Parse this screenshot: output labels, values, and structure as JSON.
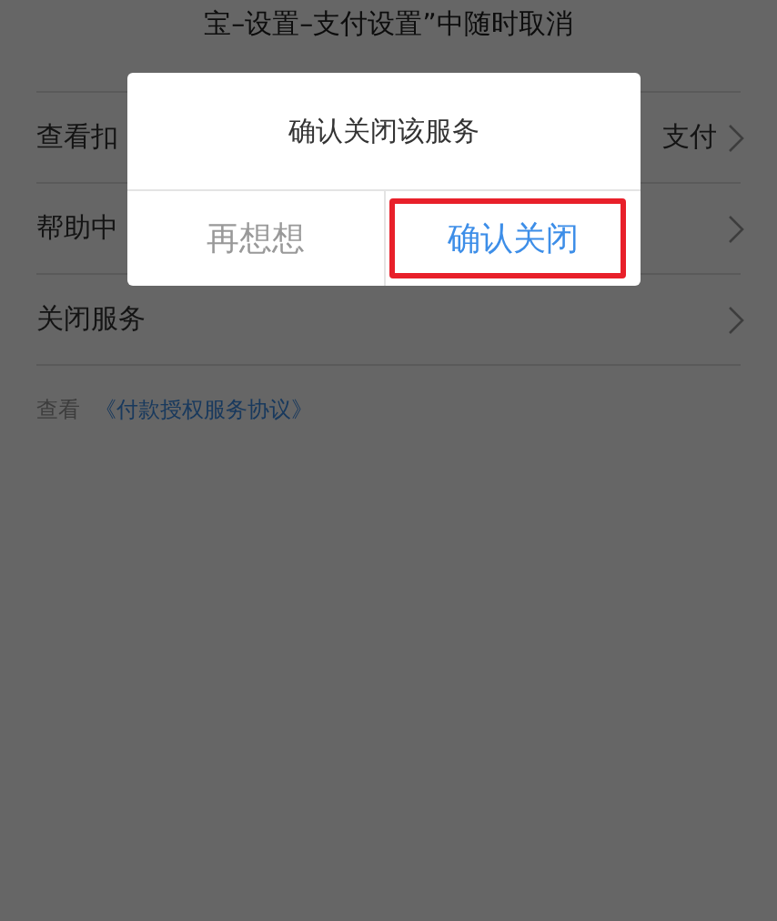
{
  "header_text": "宝–设置–支付设置”中随时取消",
  "menu_rows": [
    {
      "label": "查看扣",
      "value": "支付"
    },
    {
      "label": "帮助中"
    },
    {
      "label": "关闭服务"
    }
  ],
  "footer": {
    "prefix": "查看",
    "link": "《付款授权服务协议》"
  },
  "dialog": {
    "title": "确认关闭该服务",
    "buttons": [
      {
        "label": "再想想",
        "kind": "cancel",
        "highlighted": false
      },
      {
        "label": "确认关闭",
        "kind": "confirm",
        "highlighted": true
      }
    ]
  }
}
